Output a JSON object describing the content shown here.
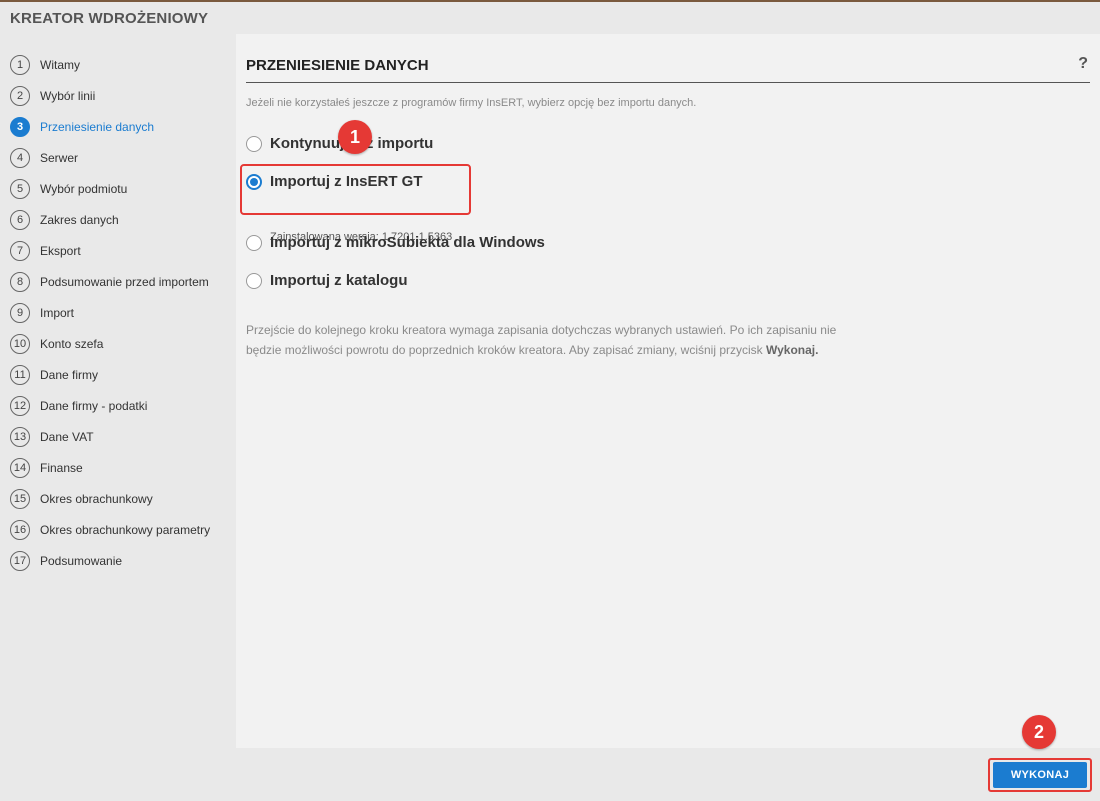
{
  "window": {
    "title": "KREATOR WDROŻENIOWY"
  },
  "steps": [
    {
      "num": "1",
      "label": "Witamy"
    },
    {
      "num": "2",
      "label": "Wybór linii"
    },
    {
      "num": "3",
      "label": "Przeniesienie danych",
      "active": true
    },
    {
      "num": "4",
      "label": "Serwer"
    },
    {
      "num": "5",
      "label": "Wybór podmiotu"
    },
    {
      "num": "6",
      "label": "Zakres danych"
    },
    {
      "num": "7",
      "label": "Eksport"
    },
    {
      "num": "8",
      "label": "Podsumowanie przed importem"
    },
    {
      "num": "9",
      "label": "Import"
    },
    {
      "num": "10",
      "label": "Konto szefa"
    },
    {
      "num": "11",
      "label": "Dane firmy"
    },
    {
      "num": "12",
      "label": "Dane firmy - podatki"
    },
    {
      "num": "13",
      "label": "Dane VAT"
    },
    {
      "num": "14",
      "label": "Finanse"
    },
    {
      "num": "15",
      "label": "Okres obrachunkowy"
    },
    {
      "num": "16",
      "label": "Okres obrachunkowy parametry"
    },
    {
      "num": "17",
      "label": "Podsumowanie"
    }
  ],
  "panel": {
    "title": "PRZENIESIENIE DANYCH",
    "help_icon": "?",
    "hint": "Jeżeli nie korzystałeś jeszcze z programów firmy InsERT, wybierz opcję bez importu danych.",
    "options": [
      {
        "label": "Kontynuuj bez importu",
        "selected": false
      },
      {
        "label": "Importuj z InsERT GT",
        "selected": true,
        "sublabel": "Zainstalowana wersja: 1.7201.1.5363"
      },
      {
        "label": "Importuj z mikroSubiekta dla Windows",
        "selected": false
      },
      {
        "label": "Importuj z katalogu",
        "selected": false
      }
    ],
    "info_text": "Przejście do kolejnego kroku kreatora wymaga zapisania dotychczas wybranych ustawień. Po ich zapisaniu nie będzie możliwości powrotu do poprzednich kroków kreatora. Aby zapisać zmiany, wciśnij przycisk",
    "info_bold": "Wykonaj."
  },
  "buttons": {
    "run": "WYKONAJ"
  },
  "annotations": {
    "badge_1": "1",
    "badge_2": "2"
  },
  "colors": {
    "accent": "#1b7cd0",
    "annotation_red": "#e53935"
  }
}
